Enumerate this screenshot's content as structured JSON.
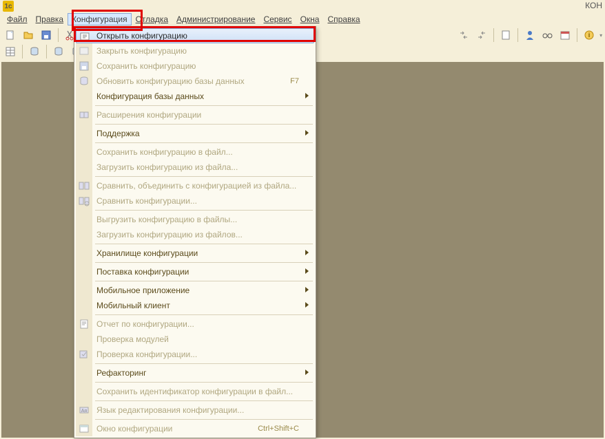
{
  "title": {
    "text": "КОН"
  },
  "menu": {
    "file": "Файл",
    "edit": "Правка",
    "configuration": "Конфигурация",
    "debug": "Отладка",
    "administration": "Администрирование",
    "service": "Сервис",
    "windows": "Окна",
    "help": "Справка"
  },
  "toolbar": {
    "icons": {
      "new": "new-file-icon",
      "open": "open-folder-icon",
      "save": "save-icon",
      "cut": "cut-icon",
      "copy": "copy-icon",
      "paste": "paste-icon",
      "undo": "undo-icon",
      "redo": "redo-icon",
      "find": "find-icon",
      "calc": "calculator-icon",
      "calendar": "calendar-icon",
      "help": "help-icon"
    }
  },
  "dropdown": {
    "items": [
      {
        "label": "Открыть конфигурацию",
        "enabled": true,
        "highlight": true,
        "icon": "open-config-icon"
      },
      {
        "label": "Закрыть конфигурацию",
        "enabled": false,
        "icon": "close-config-icon"
      },
      {
        "label": "Сохранить конфигурацию",
        "enabled": false,
        "icon": "save-config-icon"
      },
      {
        "label": "Обновить конфигурацию базы данных",
        "enabled": false,
        "shortcut": "F7",
        "icon": "update-db-icon"
      },
      {
        "label": "Конфигурация базы данных",
        "enabled": true,
        "submenu": true
      },
      {
        "sep": true
      },
      {
        "label": "Расширения конфигурации",
        "enabled": false,
        "icon": "extensions-icon"
      },
      {
        "sep": true
      },
      {
        "label": "Поддержка",
        "enabled": true,
        "submenu": true
      },
      {
        "sep": true
      },
      {
        "label": "Сохранить конфигурацию в файл...",
        "enabled": false
      },
      {
        "label": "Загрузить конфигурацию из файла...",
        "enabled": false
      },
      {
        "sep": true
      },
      {
        "label": "Сравнить, объединить с конфигурацией из файла...",
        "enabled": false,
        "icon": "compare-merge-icon"
      },
      {
        "label": "Сравнить конфигурации...",
        "enabled": false,
        "icon": "compare-icon"
      },
      {
        "sep": true
      },
      {
        "label": "Выгрузить конфигурацию в файлы...",
        "enabled": false
      },
      {
        "label": "Загрузить конфигурацию из файлов...",
        "enabled": false
      },
      {
        "sep": true
      },
      {
        "label": "Хранилище конфигурации",
        "enabled": true,
        "submenu": true
      },
      {
        "sep": true
      },
      {
        "label": "Поставка конфигурации",
        "enabled": true,
        "submenu": true
      },
      {
        "sep": true
      },
      {
        "label": "Мобильное приложение",
        "enabled": true,
        "submenu": true
      },
      {
        "label": "Мобильный клиент",
        "enabled": true,
        "submenu": true
      },
      {
        "sep": true
      },
      {
        "label": "Отчет по конфигурации...",
        "enabled": false,
        "icon": "report-icon"
      },
      {
        "label": "Проверка модулей",
        "enabled": false
      },
      {
        "label": "Проверка конфигурации...",
        "enabled": false,
        "icon": "check-config-icon"
      },
      {
        "sep": true
      },
      {
        "label": "Рефакторинг",
        "enabled": true,
        "submenu": true
      },
      {
        "sep": true
      },
      {
        "label": "Сохранить идентификатор конфигурации в файл...",
        "enabled": false
      },
      {
        "sep": true
      },
      {
        "label": "Язык редактирования конфигурации...",
        "enabled": false,
        "icon": "language-icon"
      },
      {
        "sep": true
      },
      {
        "label": "Окно конфигурации",
        "enabled": false,
        "shortcut": "Ctrl+Shift+C",
        "icon": "window-icon"
      }
    ]
  }
}
